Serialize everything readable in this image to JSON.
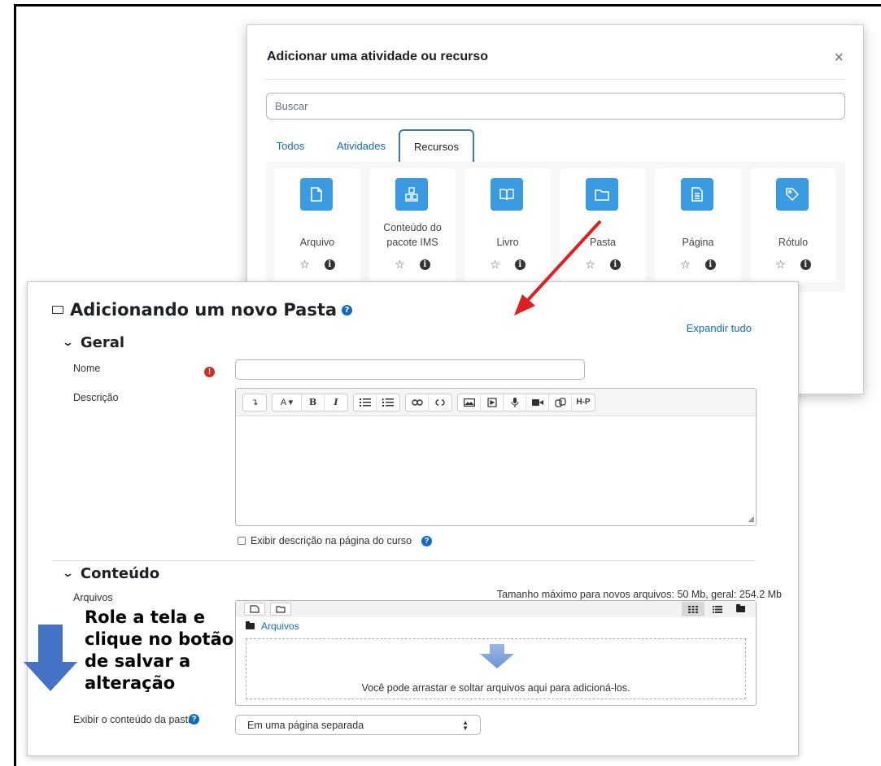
{
  "modal": {
    "title": "Adicionar uma atividade ou recurso",
    "close_glyph": "×",
    "search_placeholder": "Buscar",
    "tabs": [
      {
        "label": "Todos",
        "active": false
      },
      {
        "label": "Atividades",
        "active": false
      },
      {
        "label": "Recursos",
        "active": true
      }
    ],
    "resources": [
      {
        "label": "Arquivo",
        "icon": "file-icon"
      },
      {
        "label": "Conteúdo do pacote IMS",
        "icon": "package-icon"
      },
      {
        "label": "Livro",
        "icon": "book-icon"
      },
      {
        "label": "Pasta",
        "icon": "folder-icon"
      },
      {
        "label": "Página",
        "icon": "page-icon"
      },
      {
        "label": "Rótulo",
        "icon": "tag-icon"
      }
    ],
    "icon_color": "#399be2"
  },
  "form": {
    "title": "Adicionando um novo Pasta",
    "expand_all": "Expandir tudo",
    "sections": {
      "general": "Geral",
      "content": "Conteúdo"
    },
    "fields": {
      "name_label": "Nome",
      "description_label": "Descrição",
      "show_description_label": "Exibir descrição na página do curso",
      "files_label": "Arquivos",
      "max_size": "Tamanho máximo para novos arquivos: 50 Mb, geral: 254.2 Mb",
      "files_path": "Arquivos",
      "drop_text": "Você pode arrastar e soltar arquivos aqui para adicioná-los.",
      "display_label": "Exibir o conteúdo da pasta",
      "display_value": "Em uma página separada"
    },
    "toolbar": [
      "↴",
      "A ▾",
      "B",
      "I",
      "bullets",
      "numbers",
      "link",
      "unlink",
      "image",
      "media",
      "record-audio",
      "record-video",
      "copy",
      "H-P"
    ]
  },
  "annotations": {
    "hint": "Role a tela e clique no botão de salvar a alteração",
    "arrow_color": "#e02020",
    "down_arrow_color": "#4472c4"
  }
}
